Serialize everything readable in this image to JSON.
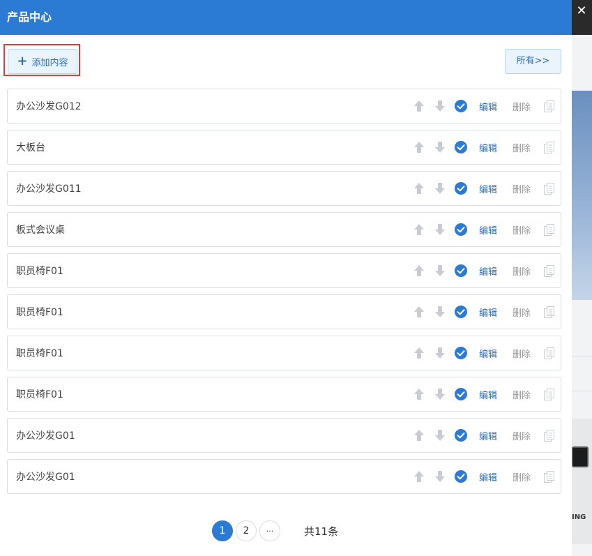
{
  "dialog": {
    "title": "产品中心",
    "close_glyph": "✕",
    "add_button_label": "添加内容",
    "add_icon_glyph": "+",
    "all_button_label": "所有>>"
  },
  "colors": {
    "header_blue": "#2b7bd4",
    "link_blue": "#2b6cb5",
    "highlight_red": "#e23a3a"
  },
  "row_actions": {
    "edit_label": "编辑",
    "delete_label": "删除",
    "icons": [
      "arrow-up-icon",
      "arrow-down-icon",
      "check-circle-icon",
      "copy-icon"
    ]
  },
  "items": [
    {
      "title": "办公沙发G012"
    },
    {
      "title": "大板台"
    },
    {
      "title": "办公沙发G011"
    },
    {
      "title": "板式会议桌"
    },
    {
      "title": "职员椅F01"
    },
    {
      "title": "职员椅F01"
    },
    {
      "title": "职员椅F01"
    },
    {
      "title": "职员椅F01"
    },
    {
      "title": "办公沙发G01"
    },
    {
      "title": "办公沙发G01"
    }
  ],
  "pagination": {
    "pages": [
      "1",
      "2"
    ],
    "current": "1",
    "ellipsis": "···",
    "total_text": "共11条"
  },
  "background_page": {
    "partial_text": "ING"
  }
}
